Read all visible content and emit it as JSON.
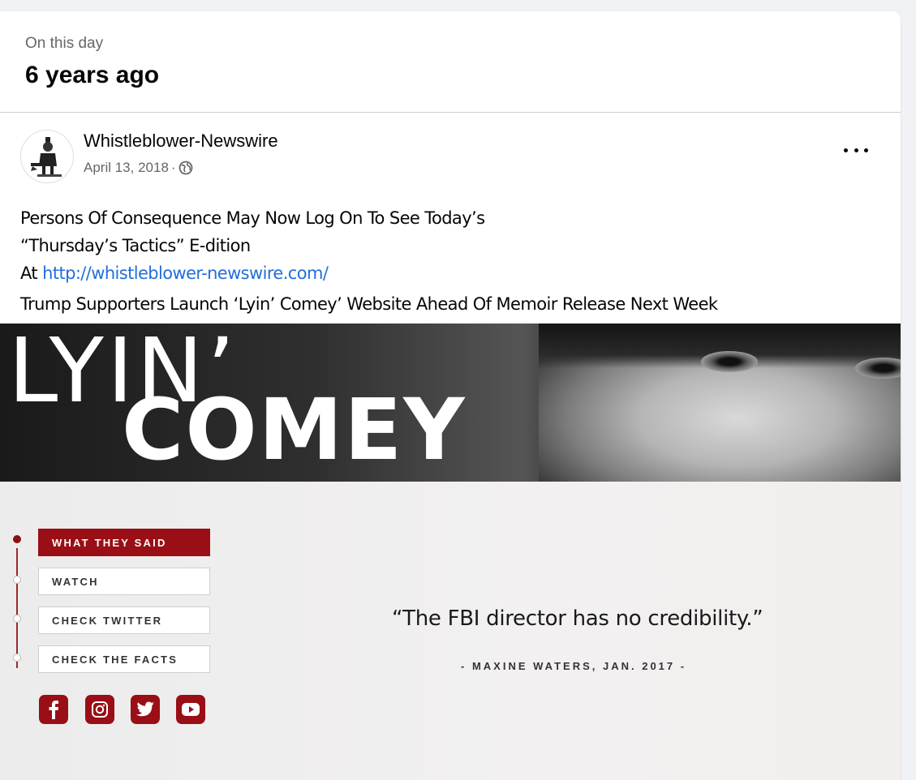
{
  "memory": {
    "subtitle": "On this day",
    "title": "6 years ago"
  },
  "post": {
    "author": "Whistleblower-Newswire",
    "date": "April 13, 2018",
    "separator": "·",
    "text_line1": "Persons Of Consequence May Now Log On To See Today’s",
    "text_line2": "“Thursday’s Tactics” E-dition",
    "text_line3_prefix": "At ",
    "link": "http://whistleblower-newswire.com/",
    "headline": "Trump Supporters Launch ‘Lyin’ Comey’ Website Ahead Of Memoir Release Next Week"
  },
  "banner": {
    "word1": "LYIN’",
    "word2": "COMEY"
  },
  "site": {
    "nav": [
      "WHAT THEY SAID",
      "WATCH",
      "CHECK TWITTER",
      "CHECK THE FACTS"
    ],
    "active_nav": "WHAT THEY SAID",
    "quote": "“The FBI director has no credibility.”",
    "attribution": "- MAXINE WATERS, JAN. 2017 -",
    "social_icons": [
      "facebook-icon",
      "instagram-icon",
      "twitter-icon",
      "youtube-icon"
    ],
    "accent_color": "#9a0e16"
  },
  "colors": {
    "link": "#216fdb",
    "meta": "#65676b"
  }
}
